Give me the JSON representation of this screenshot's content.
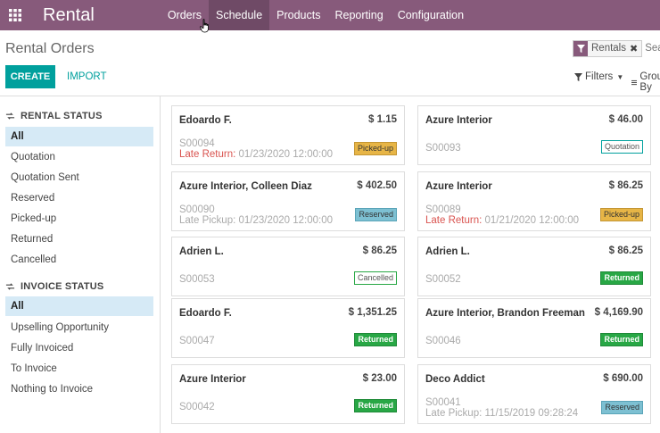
{
  "topbar": {
    "brand": "Rental",
    "menu": [
      "Orders",
      "Schedule",
      "Products",
      "Reporting",
      "Configuration"
    ]
  },
  "control": {
    "title": "Rental Orders",
    "facet_label": "Rentals",
    "search_placeholder": "Search...",
    "create_label": "CREATE",
    "import_label": "IMPORT",
    "filters_label": "Filters",
    "groupby_label": "Group By"
  },
  "sidebar": {
    "rental_status_title": "RENTAL STATUS",
    "rental_status": [
      "All",
      "Quotation",
      "Quotation Sent",
      "Reserved",
      "Picked-up",
      "Returned",
      "Cancelled"
    ],
    "invoice_status_title": "INVOICE STATUS",
    "invoice_status": [
      "All",
      "Upselling Opportunity",
      "Fully Invoiced",
      "To Invoice",
      "Nothing to Invoice"
    ]
  },
  "cards": [
    {
      "customer": "Edoardo F.",
      "amount": "$ 1.15",
      "ref": "S00094",
      "note_label": "Late Return:",
      "note_date": "01/23/2020 12:00:00",
      "note_late": true,
      "status": "Picked-up",
      "status_class": "picked-up"
    },
    {
      "customer": "Azure Interior",
      "amount": "$ 46.00",
      "ref": "S00093",
      "note_label": "",
      "note_date": "",
      "note_late": false,
      "status": "Quotation",
      "status_class": "quotation"
    },
    {
      "customer": "Azure Interior, Colleen Diaz",
      "amount": "$ 402.50",
      "ref": "S00090",
      "note_label": "Late Pickup:",
      "note_date": "01/23/2020 12:00:00",
      "note_late": false,
      "status": "Reserved",
      "status_class": "reserved"
    },
    {
      "customer": "Azure Interior",
      "amount": "$ 86.25",
      "ref": "S00089",
      "note_label": "Late Return:",
      "note_date": "01/21/2020 12:00:00",
      "note_late": true,
      "status": "Picked-up",
      "status_class": "picked-up"
    },
    {
      "customer": "Adrien L.",
      "amount": "$ 86.25",
      "ref": "S00053",
      "note_label": "",
      "note_date": "",
      "note_late": false,
      "status": "Cancelled",
      "status_class": "cancelled"
    },
    {
      "customer": "Adrien L.",
      "amount": "$ 86.25",
      "ref": "S00052",
      "note_label": "",
      "note_date": "",
      "note_late": false,
      "status": "Returned",
      "status_class": "returned"
    },
    {
      "customer": "Edoardo F.",
      "amount": "$ 1,351.25",
      "ref": "S00047",
      "note_label": "",
      "note_date": "",
      "note_late": false,
      "status": "Returned",
      "status_class": "returned"
    },
    {
      "customer": "Azure Interior, Brandon Freeman",
      "amount": "$ 4,169.90",
      "ref": "S00046",
      "note_label": "",
      "note_date": "",
      "note_late": false,
      "status": "Returned",
      "status_class": "returned"
    },
    {
      "customer": "Azure Interior",
      "amount": "$ 23.00",
      "ref": "S00042",
      "note_label": "",
      "note_date": "",
      "note_late": false,
      "status": "Returned",
      "status_class": "returned"
    },
    {
      "customer": "Deco Addict",
      "amount": "$ 690.00",
      "ref": "S00041",
      "note_label": "Late Pickup:",
      "note_date": "11/15/2019 09:28:24",
      "note_late": false,
      "status": "Reserved",
      "status_class": "reserved"
    }
  ],
  "colors": {
    "brand_purple": "#875a7b",
    "accent_teal": "#00a09d",
    "late_red": "#d9534f",
    "returned_green": "#28a745"
  }
}
